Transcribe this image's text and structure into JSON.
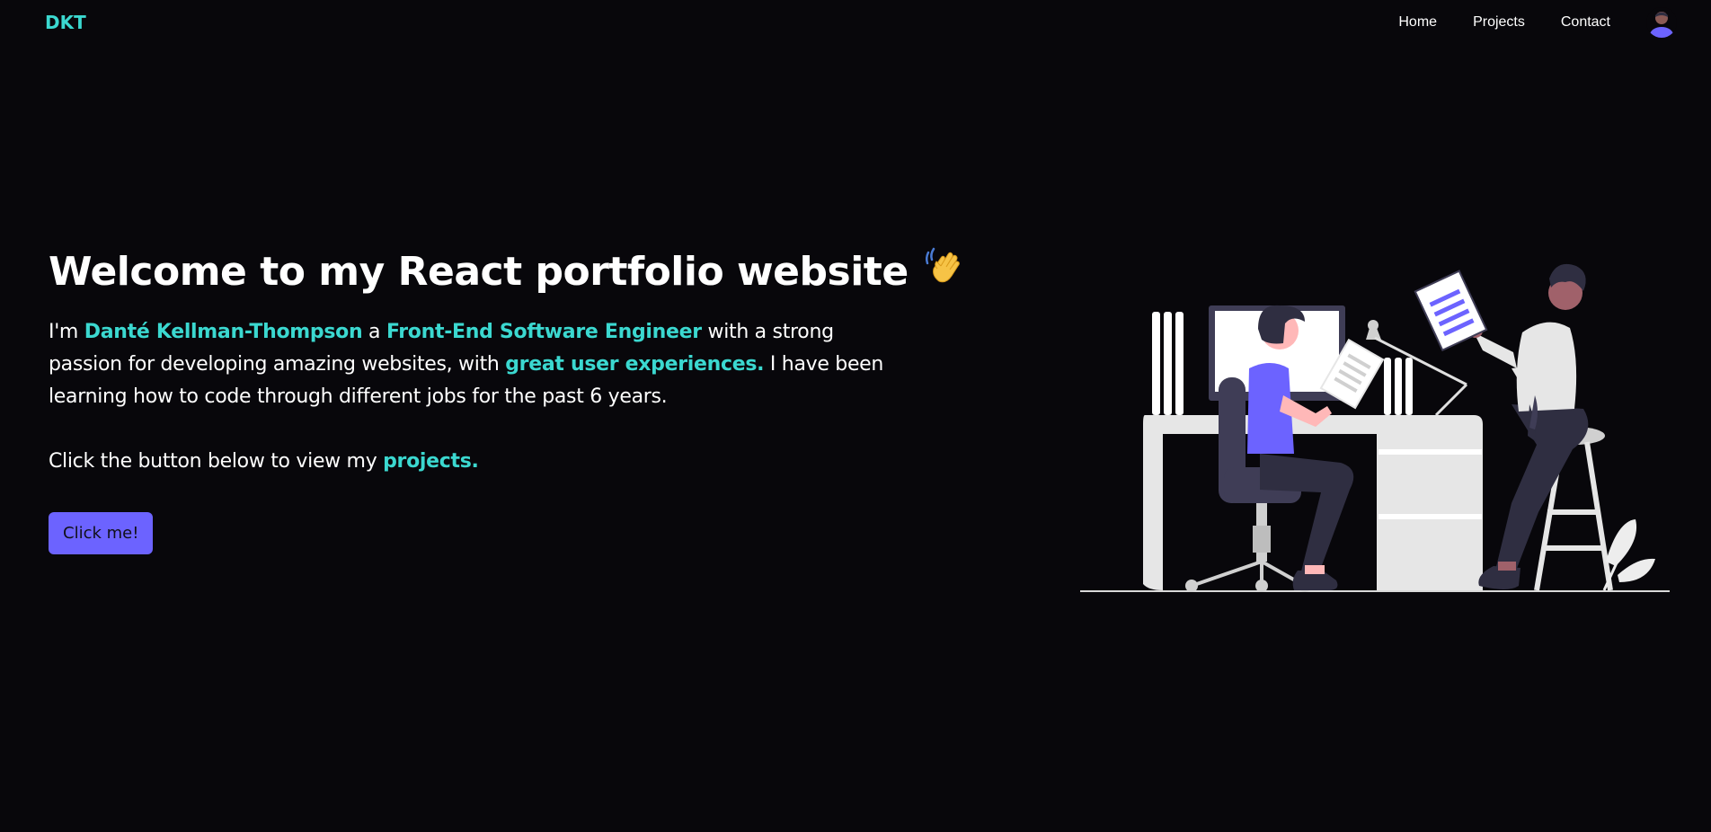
{
  "nav": {
    "brand": "DKT",
    "links": [
      "Home",
      "Projects",
      "Contact"
    ]
  },
  "hero": {
    "headline": "Welcome to my React portfolio website",
    "wave_emoji": "👋",
    "intro": {
      "p1": "I'm ",
      "name": "Danté Kellman-Thompson",
      "p2": " a ",
      "role": "Front-End Software Engineer",
      "p3": " with a strong passion for developing amazing websites, with ",
      "ux": "great user experiences.",
      "p4": " I have been learning how to code through different jobs for the past 6 years."
    },
    "cta": {
      "text": "Click the button below to view my ",
      "link": "projects."
    },
    "button": "Click me!"
  },
  "colors": {
    "background": "#08070b",
    "accent": "#3bd8d0",
    "button": "#6c63ff"
  }
}
